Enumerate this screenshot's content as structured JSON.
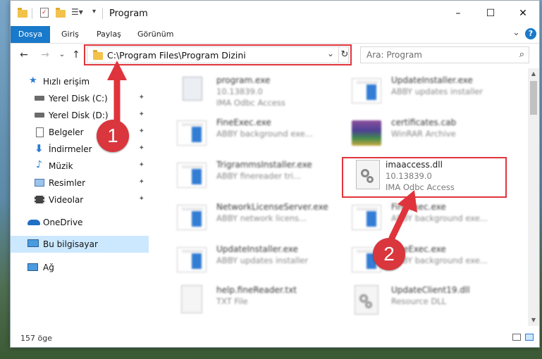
{
  "window": {
    "title": "Program",
    "controls": {
      "minimize": "–",
      "maximize": "☐",
      "close": "✕"
    }
  },
  "ribbon": {
    "tabs": [
      "Dosya",
      "Giriş",
      "Paylaş",
      "Görünüm"
    ],
    "help": "?",
    "expand": "⌄"
  },
  "navigation": {
    "back": "←",
    "forward": "→",
    "recent": "⌄",
    "up": "↑",
    "address": "C:\\Program Files\\Program Dizini",
    "address_dropdown": "⌄",
    "refresh": "↻",
    "search_placeholder": "Ara: Program",
    "search_icon": "⌕"
  },
  "sidebar": {
    "items": [
      {
        "label": "Hızlı erişim",
        "icon": "star-icon",
        "pinned": false
      },
      {
        "label": "Yerel Disk (C:)",
        "icon": "drive-icon",
        "pinned": true
      },
      {
        "label": "Yerel Disk (D:)",
        "icon": "drive-icon",
        "pinned": true
      },
      {
        "label": "Belgeler",
        "icon": "documents-icon",
        "pinned": true
      },
      {
        "label": "İndirmeler",
        "icon": "downloads-icon",
        "pinned": true
      },
      {
        "label": "Müzik",
        "icon": "music-icon",
        "pinned": true
      },
      {
        "label": "Resimler",
        "icon": "pictures-icon",
        "pinned": true
      },
      {
        "label": "Videolar",
        "icon": "videos-icon",
        "pinned": true
      },
      {
        "label": "OneDrive",
        "icon": "cloud-icon",
        "pinned": false
      },
      {
        "label": "Bu bilgisayar",
        "icon": "computer-icon",
        "pinned": false,
        "selected": true
      },
      {
        "label": "Ağ",
        "icon": "network-icon",
        "pinned": false
      }
    ],
    "pin_glyph": "📌"
  },
  "files": [
    {
      "name": "program.exe",
      "line2": "10.13839.0",
      "line3": "IMA Odbc Access",
      "icon": "application-icon"
    },
    {
      "name": "UpdateInstaller.exe",
      "line2": "ABBY updates installer",
      "line3": "",
      "icon": "application-icon"
    },
    {
      "name": "FineExec.exe",
      "line2": "ABBY background exe...",
      "line3": "",
      "icon": "application-icon"
    },
    {
      "name": "certificates.cab",
      "line2": "WinRAR Archive",
      "line3": "",
      "icon": "archive-icon"
    },
    {
      "name": "TrigrammsInstaller.exe",
      "line2": "ABBY finereader tri...",
      "line3": "",
      "icon": "application-icon"
    },
    {
      "name": "imaaccess.dll",
      "line2": "10.13839.0",
      "line3": "IMA Odbc Access",
      "icon": "dll-icon"
    },
    {
      "name": "NetworkLicenseServer.exe",
      "line2": "ABBY network licens...",
      "line3": "",
      "icon": "application-icon"
    },
    {
      "name": "FineExec.exe",
      "line2": "ABBY background exe...",
      "line3": "",
      "icon": "application-icon"
    },
    {
      "name": "UpdateInstaller.exe",
      "line2": "ABBY updates installer",
      "line3": "",
      "icon": "application-icon"
    },
    {
      "name": "FineExec.exe",
      "line2": "ABBY background exe...",
      "line3": "",
      "icon": "application-icon"
    },
    {
      "name": "help.fineReader.txt",
      "line2": "TXT File",
      "line3": "",
      "icon": "text-file-icon"
    },
    {
      "name": "UpdateClient19.dll",
      "line2": "Resource DLL",
      "line3": "",
      "icon": "dll-icon"
    }
  ],
  "status": {
    "count": "157 öge"
  },
  "annotations": {
    "step1": "1",
    "step2": "2",
    "accent": "#e0343c"
  },
  "colors": {
    "ribbon_active": "#1979ca",
    "selection": "#cce8ff",
    "folder": "#f2c24b"
  }
}
